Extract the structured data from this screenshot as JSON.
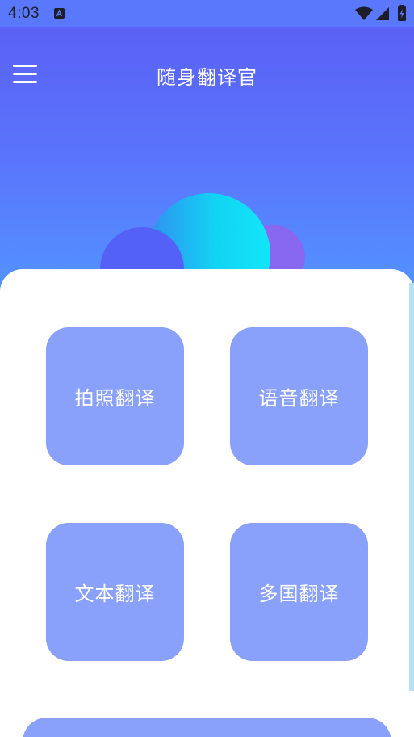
{
  "status_bar": {
    "time": "4:03",
    "notification_icon": "translate-app-icon",
    "wifi_icon": "wifi-icon",
    "signal_icon": "cell-signal-icon",
    "battery_icon": "battery-charging-icon"
  },
  "header": {
    "title": "随身翻译官",
    "menu_icon": "hamburger-menu-icon"
  },
  "features": [
    {
      "label": "拍照翻译"
    },
    {
      "label": "语音翻译"
    },
    {
      "label": "文本翻译"
    },
    {
      "label": "多国翻译"
    }
  ],
  "colors": {
    "header_gradient_top": "#5a5df5",
    "header_gradient_bottom": "#5390ff",
    "tile": "#89a1fa",
    "panel": "#ffffff"
  }
}
